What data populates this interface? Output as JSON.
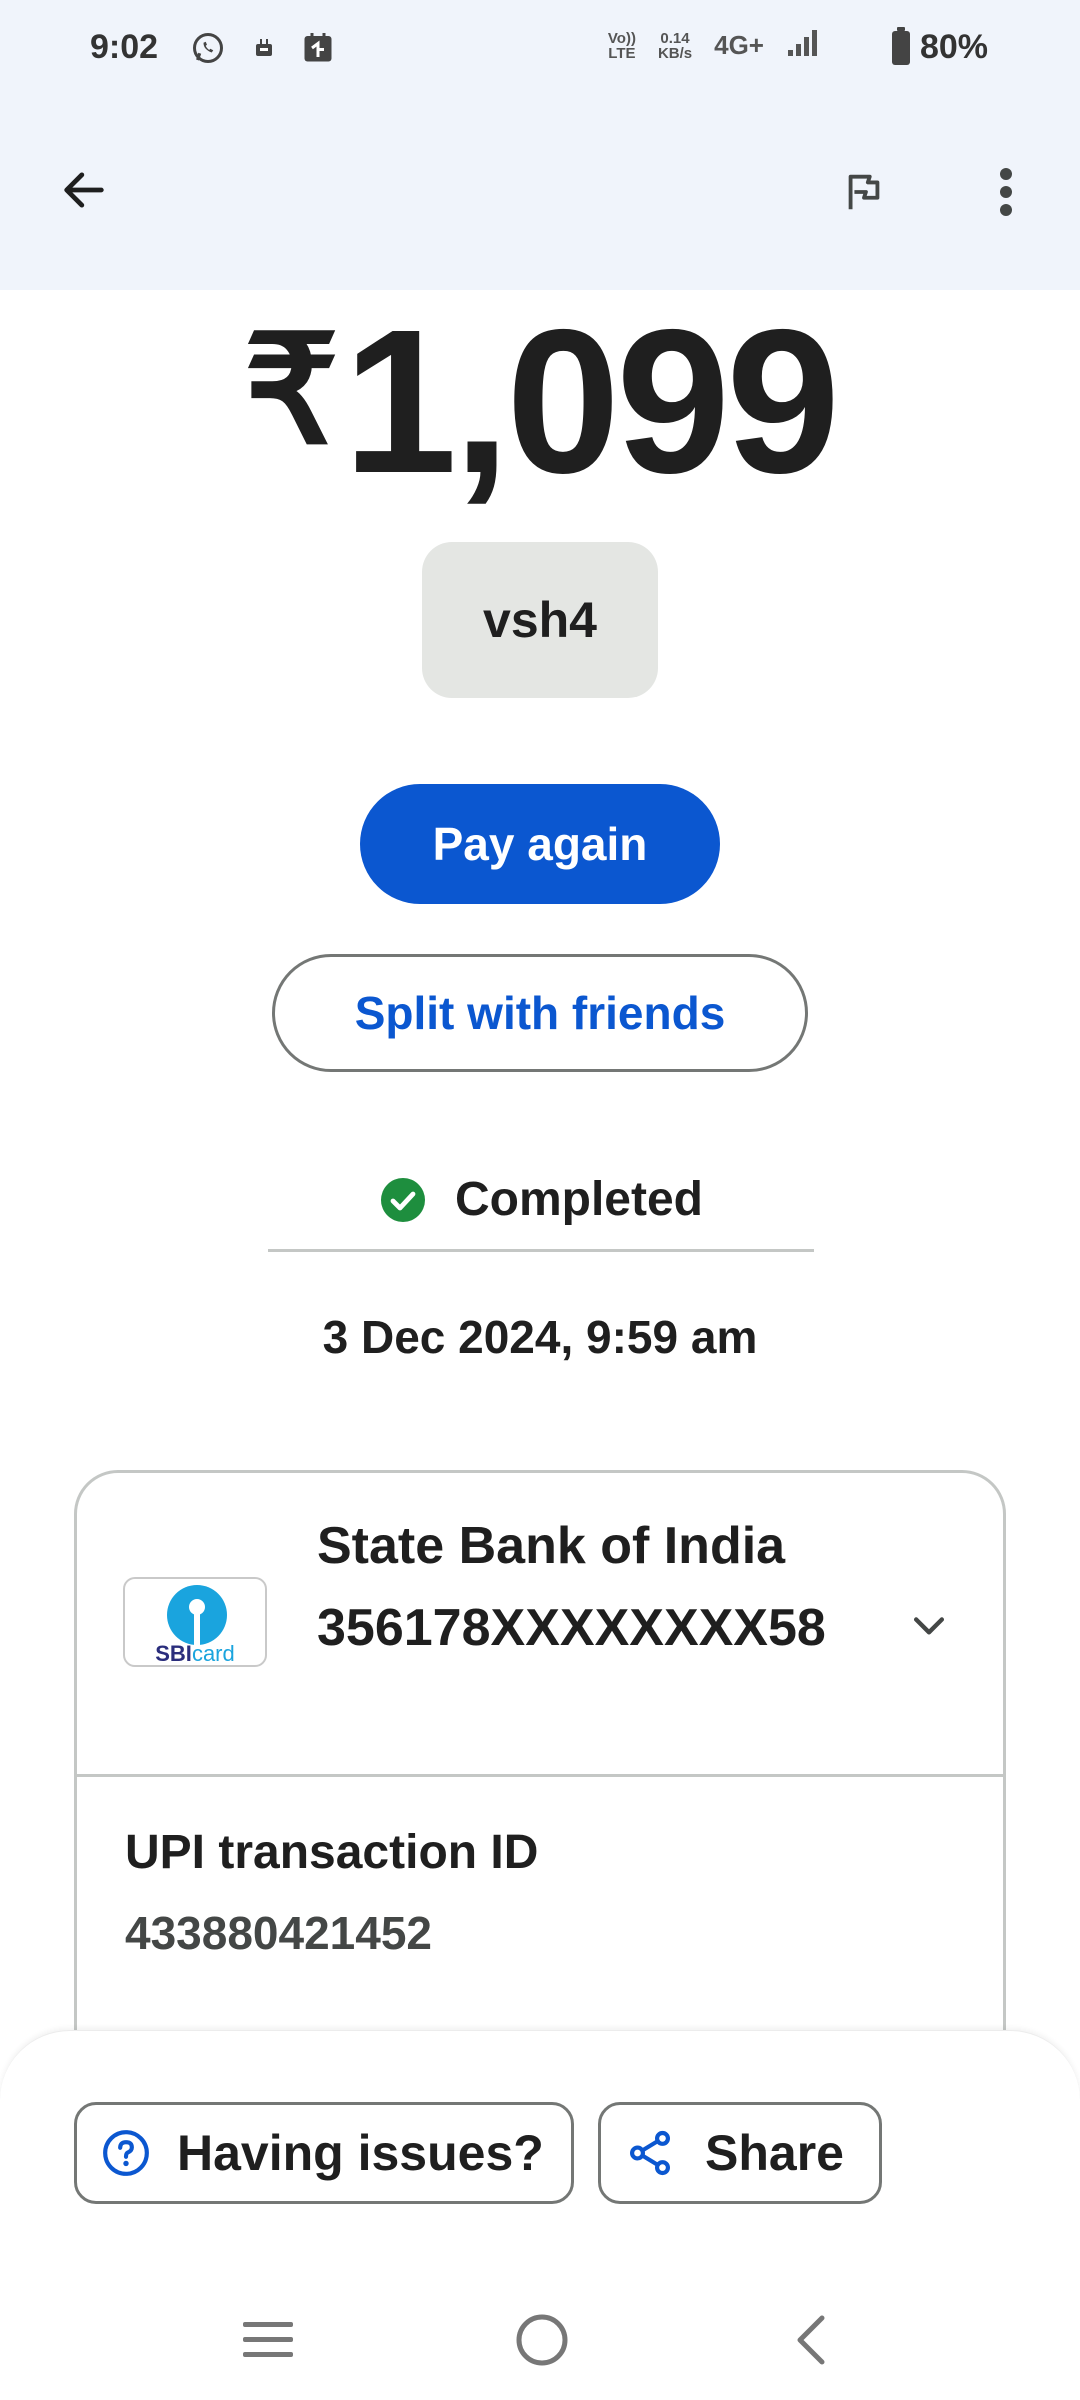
{
  "status_bar": {
    "time": "9:02",
    "volte_line1": "Vo))",
    "volte_line2": "LTE",
    "speed_line1": "0.14",
    "speed_line2": "KB/s",
    "network": "4G+",
    "battery": "80%"
  },
  "app_bar": {
    "back_icon": "arrow-back-icon",
    "flag_icon": "flag-icon",
    "more_icon": "more-vert-icon"
  },
  "transaction": {
    "currency_symbol": "₹",
    "amount": "1,099",
    "payee": "vsh4",
    "pay_again_label": "Pay again",
    "split_label": "Split with friends",
    "status": "Completed",
    "status_color": "#1e8e3e",
    "datetime": "3 Dec 2024, 9:59 am"
  },
  "payment_card": {
    "bank_logo_text_sbi": "SBI",
    "bank_logo_text_card": "card",
    "bank_name": "State Bank of India",
    "account_number": "356178XXXXXXXX58",
    "upi_label": "UPI transaction ID",
    "upi_id": "433880421452"
  },
  "bottom_actions": {
    "issues_label": "Having issues?",
    "share_label": "Share"
  },
  "colors": {
    "accent": "#0b57d0",
    "header_bg": "#f0f4fb",
    "chip_bg": "#e4e6e3"
  }
}
